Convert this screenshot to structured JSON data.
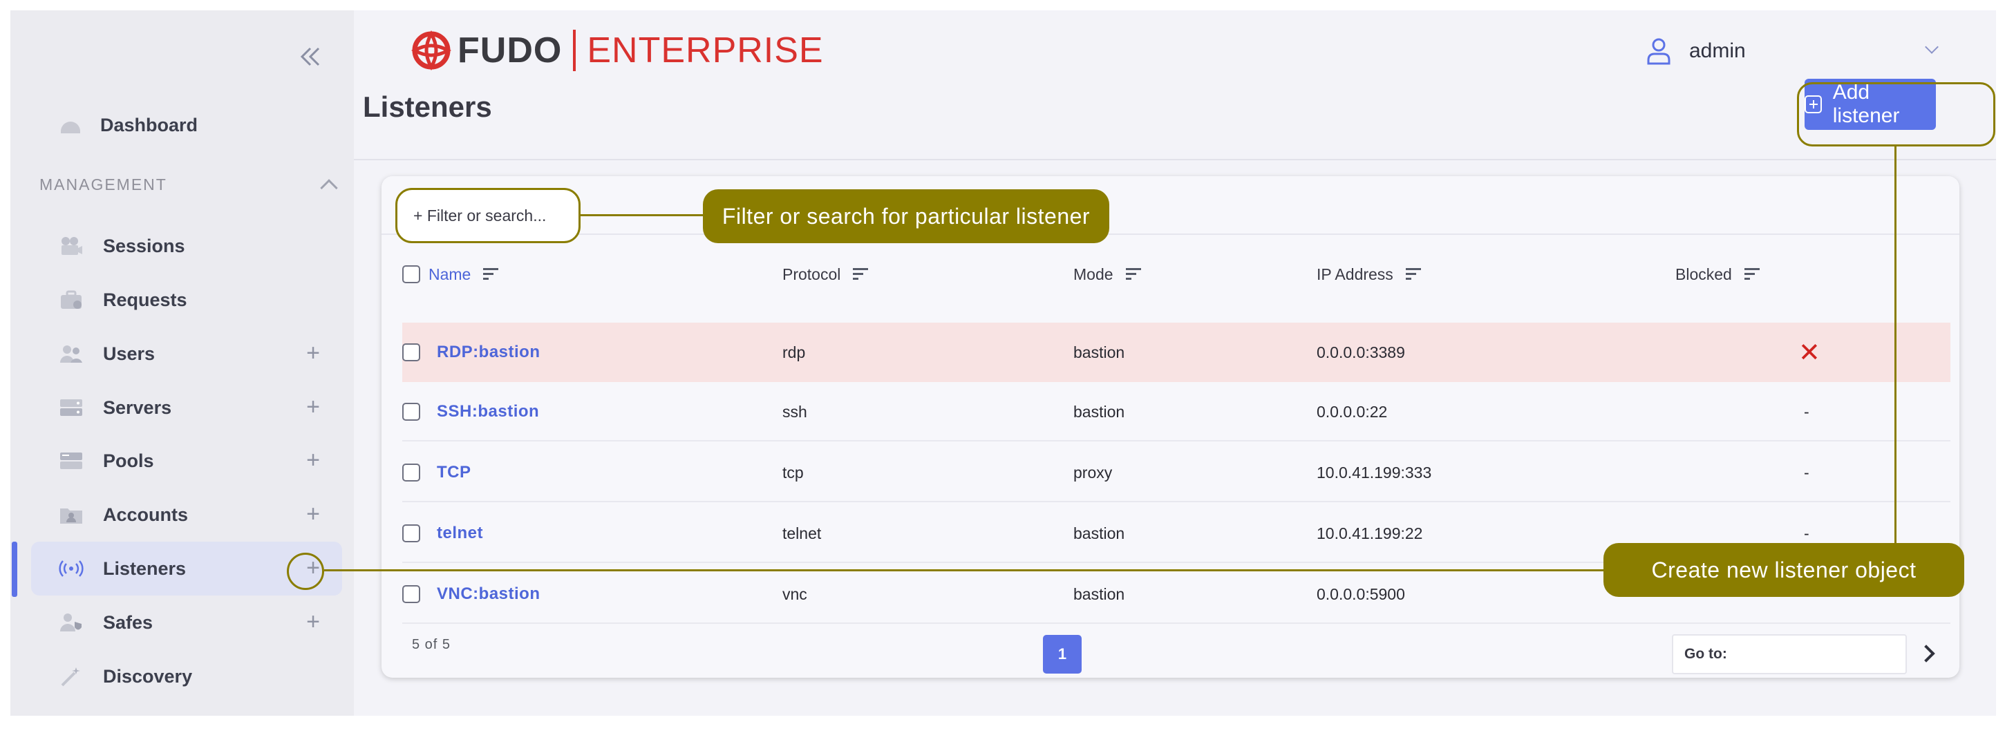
{
  "app": {
    "logo_brand": "FUDO",
    "logo_product": "ENTERPRISE",
    "colors": {
      "accent": "#5b74e8",
      "brand_red": "#d9322f",
      "annotation": "#8a7d00",
      "blocked_row": "#f8e3e3"
    }
  },
  "header": {
    "user_name": "admin",
    "user_icon": "user-icon",
    "user_menu_icon": "chevron-down-icon"
  },
  "sidebar": {
    "collapse_icon": "double-chevron-left-icon",
    "dashboard_label": "Dashboard",
    "section_label": "MANAGEMENT",
    "items": [
      {
        "label": "Sessions",
        "icon": "camera-icon",
        "has_add": false
      },
      {
        "label": "Requests",
        "icon": "briefcase-icon",
        "has_add": false
      },
      {
        "label": "Users",
        "icon": "users-icon",
        "has_add": true
      },
      {
        "label": "Servers",
        "icon": "server-icon",
        "has_add": true
      },
      {
        "label": "Pools",
        "icon": "pool-icon",
        "has_add": true
      },
      {
        "label": "Accounts",
        "icon": "account-folder-icon",
        "has_add": true
      },
      {
        "label": "Listeners",
        "icon": "broadcast-icon",
        "has_add": true,
        "active": true
      },
      {
        "label": "Safes",
        "icon": "safe-user-icon",
        "has_add": true
      },
      {
        "label": "Discovery",
        "icon": "magic-wand-icon",
        "has_add": false
      }
    ]
  },
  "main": {
    "title": "Listeners",
    "add_button_label": "Add listener",
    "filter_placeholder": "+ Filter or search...",
    "columns": [
      "Name",
      "Protocol",
      "Mode",
      "IP Address",
      "Blocked"
    ],
    "rows": [
      {
        "name": "RDP:bastion",
        "protocol": "rdp",
        "mode": "bastion",
        "ip": "0.0.0.0:3389",
        "blocked": "✕",
        "is_blocked": true
      },
      {
        "name": "SSH:bastion",
        "protocol": "ssh",
        "mode": "bastion",
        "ip": "0.0.0.0:22",
        "blocked": "-",
        "is_blocked": false
      },
      {
        "name": "TCP",
        "protocol": "tcp",
        "mode": "proxy",
        "ip": "10.0.41.199:333",
        "blocked": "-",
        "is_blocked": false
      },
      {
        "name": "telnet",
        "protocol": "telnet",
        "mode": "bastion",
        "ip": "10.0.41.199:22",
        "blocked": "-",
        "is_blocked": false
      },
      {
        "name": "VNC:bastion",
        "protocol": "vnc",
        "mode": "bastion",
        "ip": "0.0.0.0:5900",
        "blocked": "",
        "is_blocked": false
      }
    ],
    "pagination": {
      "count_text": "5 of 5",
      "current_page": "1",
      "goto_label": "Go to:"
    }
  },
  "annotations": {
    "filter_callout": "Filter or search for particular listener",
    "create_callout": "Create new listener object"
  }
}
